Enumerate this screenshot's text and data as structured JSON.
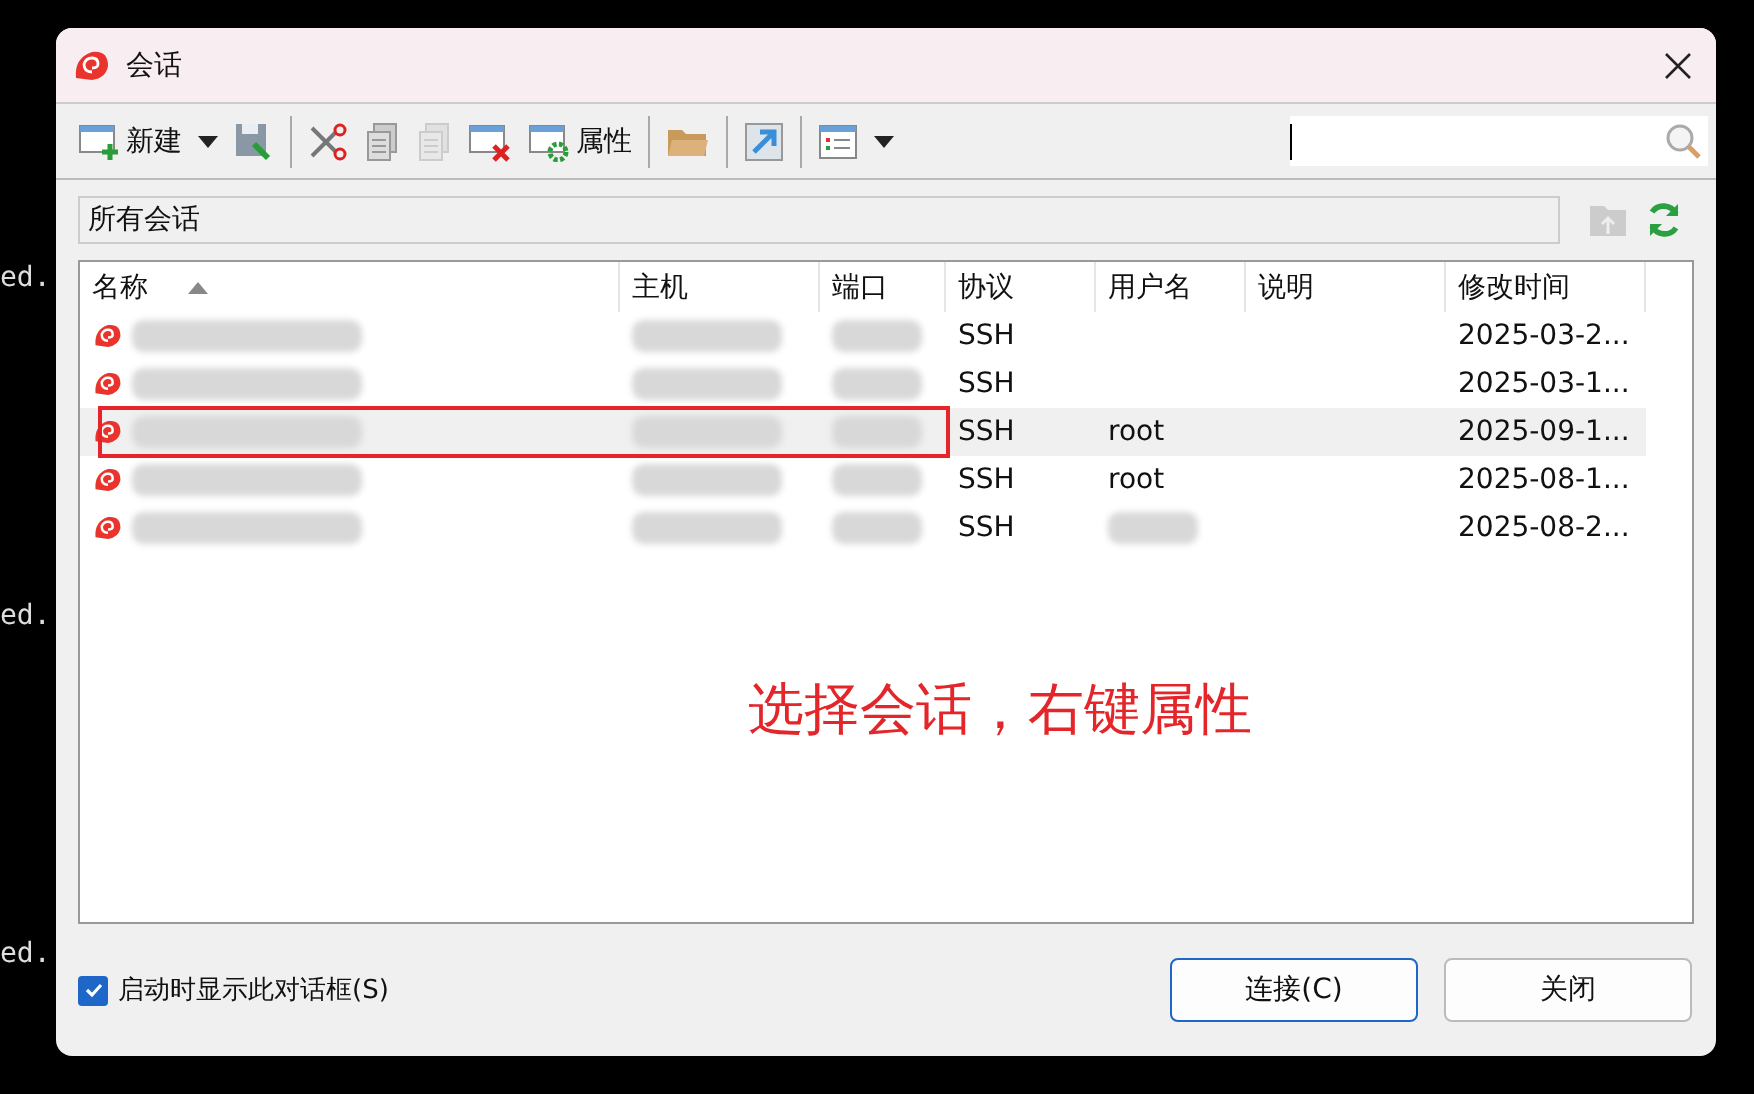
{
  "background": {
    "terminal_lines": [
      "ed.",
      "ed.",
      "ed."
    ]
  },
  "window": {
    "title": "会话"
  },
  "toolbar": [
    {
      "kind": "new",
      "label": "新建",
      "disabled": false
    },
    {
      "kind": "dropdown",
      "disabled": false
    },
    {
      "kind": "save",
      "disabled": false
    },
    {
      "kind": "separator"
    },
    {
      "kind": "cut",
      "disabled": false
    },
    {
      "kind": "copy",
      "disabled": false
    },
    {
      "kind": "paste",
      "disabled": true
    },
    {
      "kind": "delete",
      "disabled": false
    },
    {
      "kind": "properties",
      "label": "属性",
      "disabled": false
    },
    {
      "kind": "separator"
    },
    {
      "kind": "folder",
      "disabled": false
    },
    {
      "kind": "separator"
    },
    {
      "kind": "shortcut",
      "disabled": false
    },
    {
      "kind": "separator"
    },
    {
      "kind": "view",
      "disabled": false
    },
    {
      "kind": "dropdown",
      "disabled": false
    }
  ],
  "search": {
    "focused": true
  },
  "path_bar": {
    "value": "所有会话"
  },
  "table": {
    "columns": [
      {
        "label": "名称",
        "sorted": true
      },
      {
        "label": "主机",
        "sorted": false
      },
      {
        "label": "端口",
        "sorted": false
      },
      {
        "label": "协议",
        "sorted": false
      },
      {
        "label": "用户名",
        "sorted": false
      },
      {
        "label": "说明",
        "sorted": false
      },
      {
        "label": "修改时间",
        "sorted": false
      }
    ],
    "rows": [
      {
        "selected": false,
        "name_blurred": true,
        "host_blurred": true,
        "port_blurred": true,
        "protocol": "SSH",
        "user_blurred": false,
        "modified": "2025-03-2..."
      },
      {
        "selected": false,
        "name_blurred": true,
        "host_blurred": true,
        "port_blurred": true,
        "protocol": "SSH",
        "user_blurred": false,
        "modified": "2025-03-1..."
      },
      {
        "selected": true,
        "name_blurred": true,
        "host_blurred": true,
        "port_blurred": true,
        "protocol": "SSH",
        "user": "root",
        "user_blurred": false,
        "modified": "2025-09-1..."
      },
      {
        "selected": false,
        "name_blurred": true,
        "host_blurred": true,
        "port_blurred": true,
        "protocol": "SSH",
        "user": "root",
        "user_blurred": false,
        "modified": "2025-08-1..."
      },
      {
        "selected": false,
        "name_blurred": true,
        "host_blurred": true,
        "port_blurred": true,
        "protocol": "SSH",
        "user_blurred": true,
        "modified": "2025-08-2..."
      }
    ]
  },
  "annotation": {
    "text": "选择会话，右键属性"
  },
  "startup_checkbox": {
    "label": "启动时显示此对话框(S)",
    "checked": true
  },
  "buttons": [
    {
      "label": "连接(C)",
      "default": true
    },
    {
      "label": "关闭",
      "default": false
    }
  ]
}
